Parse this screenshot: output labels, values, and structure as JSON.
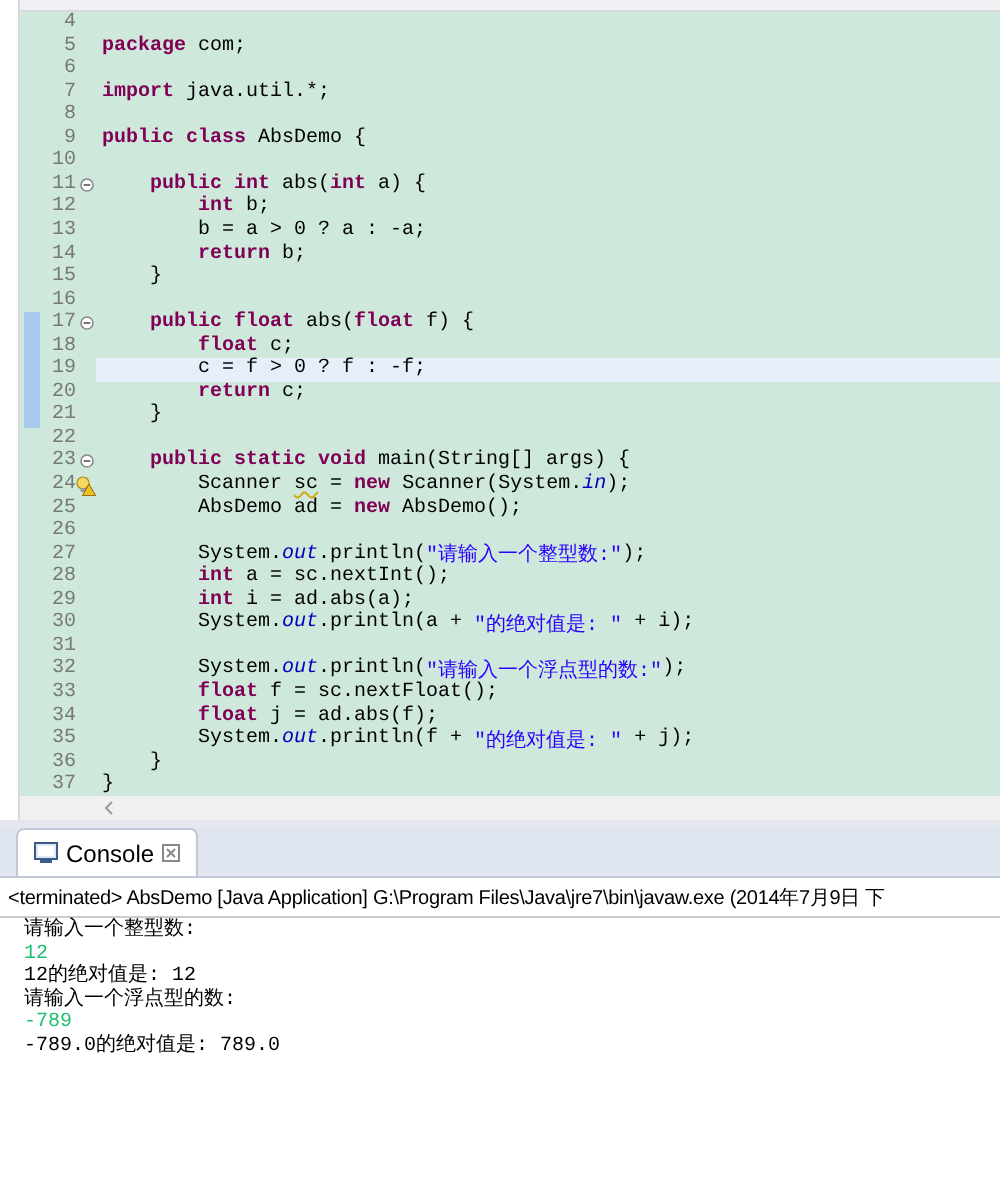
{
  "editor": {
    "lines": [
      {
        "number": "4",
        "kind": "plain",
        "changed": false,
        "highlighted": false
      },
      {
        "number": "5",
        "kind": "plain",
        "changed": false,
        "highlighted": false,
        "tokens": [
          {
            "kind": "keyword",
            "text": "package"
          },
          {
            "kind": "plain",
            "text": " com;"
          }
        ]
      },
      {
        "number": "6",
        "kind": "plain",
        "changed": false,
        "highlighted": false
      },
      {
        "number": "7",
        "kind": "plain",
        "changed": false,
        "highlighted": false,
        "tokens": [
          {
            "kind": "keyword",
            "text": "import"
          },
          {
            "kind": "plain",
            "text": " java.util.*;"
          }
        ]
      },
      {
        "number": "8",
        "kind": "plain",
        "changed": false,
        "highlighted": false
      },
      {
        "number": "9",
        "kind": "plain",
        "changed": false,
        "highlighted": false,
        "tokens": [
          {
            "kind": "keyword",
            "text": "public class"
          },
          {
            "kind": "plain",
            "text": " AbsDemo {"
          }
        ]
      },
      {
        "number": "10",
        "kind": "plain",
        "changed": false,
        "highlighted": false
      },
      {
        "number": "11",
        "kind": "fold",
        "changed": false,
        "highlighted": false,
        "tokens": [
          {
            "kind": "keyword",
            "text": "    public int"
          },
          {
            "kind": "plain",
            "text": " abs("
          },
          {
            "kind": "keyword",
            "text": "int"
          },
          {
            "kind": "plain",
            "text": " a) {"
          }
        ]
      },
      {
        "number": "12",
        "kind": "plain",
        "changed": false,
        "highlighted": false,
        "tokens": [
          {
            "kind": "keyword",
            "text": "        int"
          },
          {
            "kind": "plain",
            "text": " b;"
          }
        ]
      },
      {
        "number": "13",
        "kind": "plain",
        "changed": false,
        "highlighted": false,
        "tokens": [
          {
            "kind": "plain",
            "text": "        b = a > 0 ? a : -a;"
          }
        ]
      },
      {
        "number": "14",
        "kind": "plain",
        "changed": false,
        "highlighted": false,
        "tokens": [
          {
            "kind": "keyword",
            "text": "        return"
          },
          {
            "kind": "plain",
            "text": " b;"
          }
        ]
      },
      {
        "number": "15",
        "kind": "plain",
        "changed": false,
        "highlighted": false,
        "tokens": [
          {
            "kind": "plain",
            "text": "    }"
          }
        ]
      },
      {
        "number": "16",
        "kind": "plain",
        "changed": false,
        "highlighted": false
      },
      {
        "number": "17",
        "kind": "fold",
        "changed": true,
        "highlighted": false,
        "tokens": [
          {
            "kind": "keyword",
            "text": "    public float"
          },
          {
            "kind": "plain",
            "text": " abs("
          },
          {
            "kind": "keyword",
            "text": "float"
          },
          {
            "kind": "plain",
            "text": " f) {"
          }
        ]
      },
      {
        "number": "18",
        "kind": "plain",
        "changed": true,
        "highlighted": false,
        "tokens": [
          {
            "kind": "keyword",
            "text": "        float"
          },
          {
            "kind": "plain",
            "text": " c;"
          }
        ]
      },
      {
        "number": "19",
        "kind": "plain",
        "changed": true,
        "highlighted": true,
        "tokens": [
          {
            "kind": "plain",
            "text": "        c = f > 0 ? f : -f;"
          }
        ]
      },
      {
        "number": "20",
        "kind": "plain",
        "changed": true,
        "highlighted": false,
        "tokens": [
          {
            "kind": "keyword",
            "text": "        return"
          },
          {
            "kind": "plain",
            "text": " c;"
          }
        ]
      },
      {
        "number": "21",
        "kind": "plain",
        "changed": true,
        "highlighted": false,
        "tokens": [
          {
            "kind": "plain",
            "text": "    }"
          }
        ]
      },
      {
        "number": "22",
        "kind": "plain",
        "changed": false,
        "highlighted": false
      },
      {
        "number": "23",
        "kind": "fold",
        "changed": false,
        "highlighted": false,
        "tokens": [
          {
            "kind": "keyword",
            "text": "    public static void"
          },
          {
            "kind": "plain",
            "text": " main(String[] args) {"
          }
        ]
      },
      {
        "number": "24",
        "kind": "warning",
        "changed": false,
        "highlighted": false,
        "tokens": [
          {
            "kind": "plain",
            "text": "        Scanner "
          },
          {
            "kind": "warn",
            "text": "sc"
          },
          {
            "kind": "plain",
            "text": " = "
          },
          {
            "kind": "keyword",
            "text": "new"
          },
          {
            "kind": "plain",
            "text": " Scanner(System."
          },
          {
            "kind": "static",
            "text": "in"
          },
          {
            "kind": "plain",
            "text": ");"
          }
        ]
      },
      {
        "number": "25",
        "kind": "plain",
        "changed": false,
        "highlighted": false,
        "tokens": [
          {
            "kind": "plain",
            "text": "        AbsDemo ad = "
          },
          {
            "kind": "keyword",
            "text": "new"
          },
          {
            "kind": "plain",
            "text": " AbsDemo();"
          }
        ]
      },
      {
        "number": "26",
        "kind": "plain",
        "changed": false,
        "highlighted": false
      },
      {
        "number": "27",
        "kind": "plain",
        "changed": false,
        "highlighted": false,
        "tokens": [
          {
            "kind": "plain",
            "text": "        System."
          },
          {
            "kind": "static",
            "text": "out"
          },
          {
            "kind": "plain",
            "text": ".println("
          },
          {
            "kind": "string",
            "text": "\"请输入一个整型数:\""
          },
          {
            "kind": "plain",
            "text": ");"
          }
        ]
      },
      {
        "number": "28",
        "kind": "plain",
        "changed": false,
        "highlighted": false,
        "tokens": [
          {
            "kind": "keyword",
            "text": "        int"
          },
          {
            "kind": "plain",
            "text": " a = sc.nextInt();"
          }
        ]
      },
      {
        "number": "29",
        "kind": "plain",
        "changed": false,
        "highlighted": false,
        "tokens": [
          {
            "kind": "keyword",
            "text": "        int"
          },
          {
            "kind": "plain",
            "text": " i = ad.abs(a);"
          }
        ]
      },
      {
        "number": "30",
        "kind": "plain",
        "changed": false,
        "highlighted": false,
        "tokens": [
          {
            "kind": "plain",
            "text": "        System."
          },
          {
            "kind": "static",
            "text": "out"
          },
          {
            "kind": "plain",
            "text": ".println(a + "
          },
          {
            "kind": "string",
            "text": "\"的绝对值是: \""
          },
          {
            "kind": "plain",
            "text": " + i);"
          }
        ]
      },
      {
        "number": "31",
        "kind": "plain",
        "changed": false,
        "highlighted": false
      },
      {
        "number": "32",
        "kind": "plain",
        "changed": false,
        "highlighted": false,
        "tokens": [
          {
            "kind": "plain",
            "text": "        System."
          },
          {
            "kind": "static",
            "text": "out"
          },
          {
            "kind": "plain",
            "text": ".println("
          },
          {
            "kind": "string",
            "text": "\"请输入一个浮点型的数:\""
          },
          {
            "kind": "plain",
            "text": ");"
          }
        ]
      },
      {
        "number": "33",
        "kind": "plain",
        "changed": false,
        "highlighted": false,
        "tokens": [
          {
            "kind": "keyword",
            "text": "        float"
          },
          {
            "kind": "plain",
            "text": " f = sc.nextFloat();"
          }
        ]
      },
      {
        "number": "34",
        "kind": "plain",
        "changed": false,
        "highlighted": false,
        "tokens": [
          {
            "kind": "keyword",
            "text": "        float"
          },
          {
            "kind": "plain",
            "text": " j = ad.abs(f);"
          }
        ]
      },
      {
        "number": "35",
        "kind": "plain",
        "changed": false,
        "highlighted": false,
        "tokens": [
          {
            "kind": "plain",
            "text": "        System."
          },
          {
            "kind": "static",
            "text": "out"
          },
          {
            "kind": "plain",
            "text": ".println(f + "
          },
          {
            "kind": "string",
            "text": "\"的绝对值是: \""
          },
          {
            "kind": "plain",
            "text": " + j);"
          }
        ]
      },
      {
        "number": "36",
        "kind": "plain",
        "changed": false,
        "highlighted": false,
        "tokens": [
          {
            "kind": "plain",
            "text": "    }"
          }
        ]
      },
      {
        "number": "37",
        "kind": "plain",
        "changed": false,
        "highlighted": false,
        "tokens": [
          {
            "kind": "plain",
            "text": "}"
          }
        ]
      }
    ]
  },
  "console": {
    "tab": {
      "label": "Console",
      "selected": true
    },
    "description": "<terminated> AbsDemo [Java Application] G:\\Program Files\\Java\\jre7\\bin\\javaw.exe (2014年7月9日 下",
    "output": [
      {
        "kind": "output",
        "text": "请输入一个整型数:"
      },
      {
        "kind": "input",
        "text": "12"
      },
      {
        "kind": "output",
        "text": "12的绝对值是: 12"
      },
      {
        "kind": "output",
        "text": "请输入一个浮点型的数:"
      },
      {
        "kind": "input",
        "text": "-789"
      },
      {
        "kind": "output",
        "text": "-789.0的绝对值是: 789.0"
      }
    ]
  }
}
